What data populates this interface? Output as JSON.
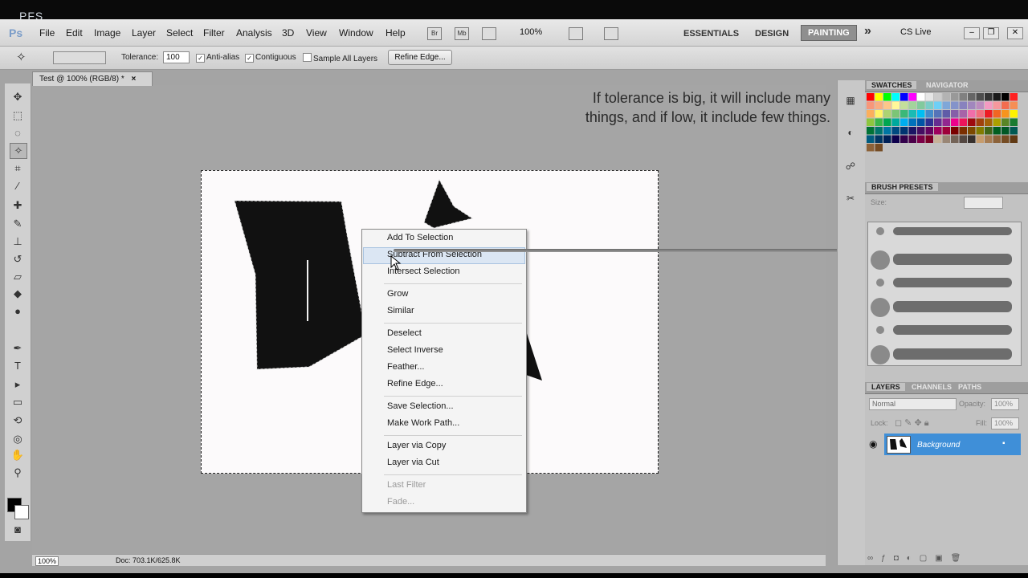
{
  "watermark": "PFS",
  "menubar": {
    "logo": "Ps",
    "items": [
      "File",
      "Edit",
      "Image",
      "Layer",
      "Select",
      "Filter",
      "Analysis",
      "3D",
      "View",
      "Window",
      "Help"
    ],
    "icons": [
      "Br",
      "Mb"
    ],
    "zoom": "100%",
    "workspaces": [
      "ESSENTIALS",
      "DESIGN"
    ],
    "active_workspace": "PAINTING",
    "more": "»",
    "cs_live": "CS Live"
  },
  "options": {
    "tolerance_label": "Tolerance:",
    "tolerance_value": "100",
    "anti_alias": "Anti-alias",
    "contiguous": "Contiguous",
    "sample_all": "Sample All Layers",
    "refine_edge": "Refine Edge..."
  },
  "document": {
    "tab_title": "Test @ 100% (RGB/8) *",
    "close": "×",
    "annotation_line1": "If tolerance is big, it will include many",
    "annotation_line2": "things, and if low, it include few things."
  },
  "context_menu": {
    "items": [
      {
        "label": "Add To Selection",
        "disabled": false
      },
      {
        "label": "Subtract From Selection",
        "disabled": false
      },
      {
        "label": "Intersect Selection",
        "disabled": false
      },
      {
        "label": "Grow",
        "disabled": false
      },
      {
        "label": "Similar",
        "disabled": false
      },
      {
        "label": "Deselect",
        "disabled": false
      },
      {
        "label": "Select Inverse",
        "disabled": false
      },
      {
        "label": "Feather...",
        "disabled": false
      },
      {
        "label": "Refine Edge...",
        "disabled": false
      },
      {
        "label": "Save Selection...",
        "disabled": false
      },
      {
        "label": "Make Work Path...",
        "disabled": false
      },
      {
        "label": "Layer via Copy",
        "disabled": false
      },
      {
        "label": "Layer via Cut",
        "disabled": false
      },
      {
        "label": "Last Filter",
        "disabled": true
      },
      {
        "label": "Fade...",
        "disabled": true
      }
    ],
    "highlighted": "Subtract From Selection"
  },
  "status": {
    "zoom": "100%",
    "doc": "Doc: 703.1K/625.8K"
  },
  "panels": {
    "swatches_tab": "SWATCHES",
    "navigator_tab": "NAVIGATOR",
    "brush_presets_tab": "BRUSH PRESETS",
    "size_label": "Size:",
    "layers_tab": "LAYERS",
    "channels_tab": "CHANNELS",
    "paths_tab": "PATHS",
    "blend_mode": "Normal",
    "opacity_label": "Opacity:",
    "opacity_value": "100%",
    "lock_label": "Lock:",
    "fill_label": "Fill:",
    "fill_value": "100%",
    "layer_name": "Background"
  },
  "colors": {
    "accent": "#3f8fd8",
    "highlight": "#dbe6f3",
    "workspace_active": "#8f8f8f"
  }
}
